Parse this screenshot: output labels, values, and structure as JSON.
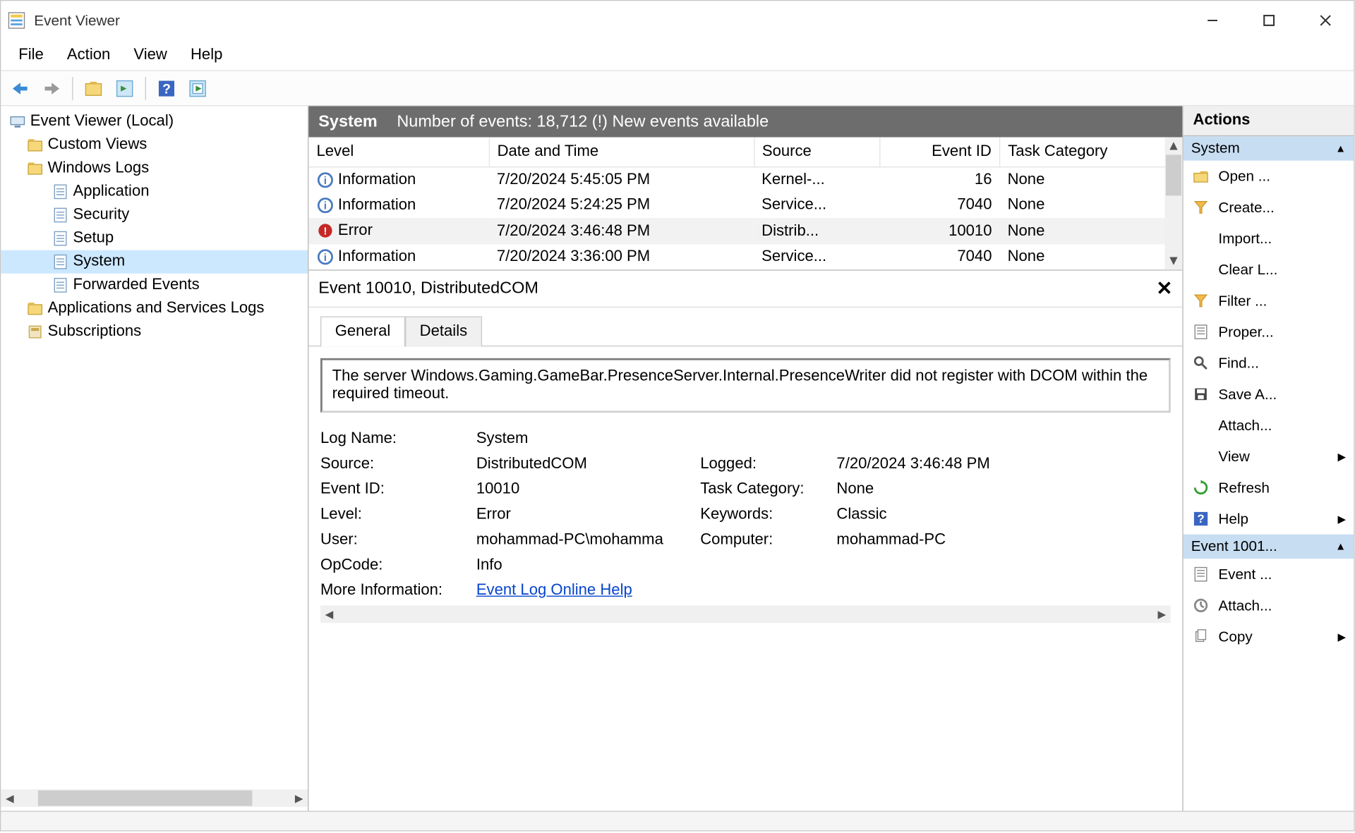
{
  "window": {
    "title": "Event Viewer"
  },
  "menus": [
    "File",
    "Action",
    "View",
    "Help"
  ],
  "tree": {
    "root": "Event Viewer (Local)",
    "nodes": [
      {
        "label": "Custom Views",
        "indent": 1,
        "icon": "folder"
      },
      {
        "label": "Windows Logs",
        "indent": 1,
        "icon": "folder"
      },
      {
        "label": "Application",
        "indent": 2,
        "icon": "log"
      },
      {
        "label": "Security",
        "indent": 2,
        "icon": "log"
      },
      {
        "label": "Setup",
        "indent": 2,
        "icon": "log"
      },
      {
        "label": "System",
        "indent": 2,
        "icon": "log",
        "selected": true
      },
      {
        "label": "Forwarded Events",
        "indent": 2,
        "icon": "log"
      },
      {
        "label": "Applications and Services Logs",
        "indent": 1,
        "icon": "folder"
      },
      {
        "label": "Subscriptions",
        "indent": 1,
        "icon": "sub"
      }
    ]
  },
  "center": {
    "header_name": "System",
    "header_info": "Number of events: 18,712 (!) New events available",
    "columns": [
      "Level",
      "Date and Time",
      "Source",
      "Event ID",
      "Task Category"
    ],
    "rows": [
      {
        "level": "Information",
        "lvl": "info",
        "date": "7/20/2024 5:45:05 PM",
        "source": "Kernel-...",
        "id": "16",
        "cat": "None"
      },
      {
        "level": "Information",
        "lvl": "info",
        "date": "7/20/2024 5:24:25 PM",
        "source": "Service...",
        "id": "7040",
        "cat": "None"
      },
      {
        "level": "Error",
        "lvl": "error",
        "date": "7/20/2024 3:46:48 PM",
        "source": "Distrib...",
        "id": "10010",
        "cat": "None",
        "selected": true
      },
      {
        "level": "Information",
        "lvl": "info",
        "date": "7/20/2024 3:36:00 PM",
        "source": "Service...",
        "id": "7040",
        "cat": "None"
      }
    ]
  },
  "detail": {
    "title": "Event 10010, DistributedCOM",
    "tabs": [
      "General",
      "Details"
    ],
    "message": "The server Windows.Gaming.GameBar.PresenceServer.Internal.PresenceWriter did not register with DCOM within the required timeout.",
    "properties": {
      "log_name_label": "Log Name:",
      "log_name": "System",
      "source_label": "Source:",
      "source": "DistributedCOM",
      "logged_label": "Logged:",
      "logged": "7/20/2024 3:46:48 PM",
      "event_id_label": "Event ID:",
      "event_id": "10010",
      "task_cat_label": "Task Category:",
      "task_cat": "None",
      "level_label": "Level:",
      "level": "Error",
      "keywords_label": "Keywords:",
      "keywords": "Classic",
      "user_label": "User:",
      "user": "mohammad-PC\\mohamma",
      "computer_label": "Computer:",
      "computer": "mohammad-PC",
      "opcode_label": "OpCode:",
      "opcode": "Info",
      "more_info_label": "More Information:",
      "more_info_link": "Event Log Online Help"
    }
  },
  "actions": {
    "title": "Actions",
    "sections": [
      {
        "header": "System",
        "items": [
          {
            "label": "Open ...",
            "icon": "folder-open"
          },
          {
            "label": "Create...",
            "icon": "filter"
          },
          {
            "label": "Import...",
            "icon": ""
          },
          {
            "label": "Clear L...",
            "icon": ""
          },
          {
            "label": "Filter ...",
            "icon": "filter"
          },
          {
            "label": "Proper...",
            "icon": "props"
          },
          {
            "label": "Find...",
            "icon": "find"
          },
          {
            "label": "Save A...",
            "icon": "save"
          },
          {
            "label": "Attach...",
            "icon": ""
          },
          {
            "label": "View",
            "icon": "",
            "sub": true
          },
          {
            "label": "Refresh",
            "icon": "refresh"
          },
          {
            "label": "Help",
            "icon": "help",
            "sub": true
          }
        ]
      },
      {
        "header": "Event 1001...",
        "items": [
          {
            "label": "Event ...",
            "icon": "props"
          },
          {
            "label": "Attach...",
            "icon": "attach"
          },
          {
            "label": "Copy",
            "icon": "copy",
            "sub": true
          }
        ]
      }
    ]
  }
}
